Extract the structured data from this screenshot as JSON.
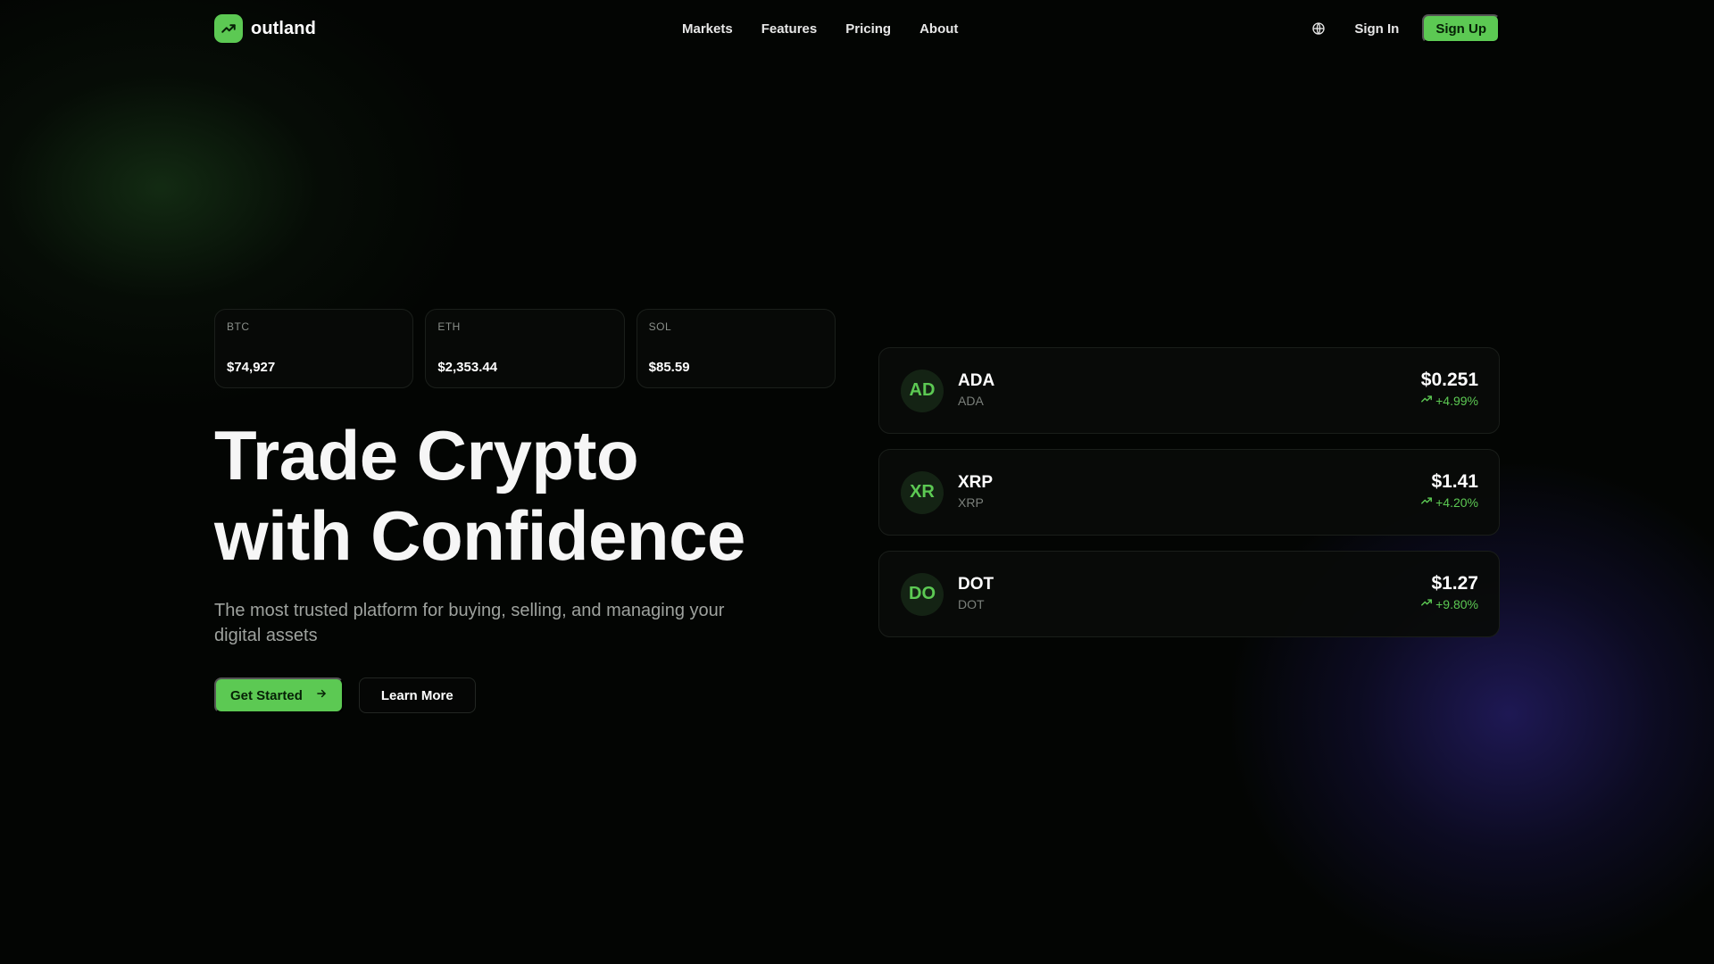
{
  "theme": {
    "accent": "#5cc953",
    "background": "#030503",
    "glow_green": "#1e4a1e",
    "glow_blue": "#3428a0"
  },
  "navbar": {
    "brand_name": "outland",
    "brand_icon": "trending-up-icon",
    "links": [
      "Markets",
      "Features",
      "Pricing",
      "About"
    ],
    "language_icon": "globe-icon",
    "sign_in": "Sign In",
    "sign_up": "Sign Up"
  },
  "tickers": [
    {
      "symbol": "BTC",
      "price": "$74,927"
    },
    {
      "symbol": "ETH",
      "price": "$2,353.44"
    },
    {
      "symbol": "SOL",
      "price": "$85.59"
    }
  ],
  "hero": {
    "title_line_1": "Trade Crypto",
    "title_line_2": "with Confidence",
    "subtitle": "The most trusted platform for buying, selling, and managing your digital assets",
    "primary_cta": "Get Started",
    "primary_cta_icon": "arrow-right-icon",
    "secondary_cta": "Learn More"
  },
  "markets": [
    {
      "avatar": "AD",
      "name": "ADA",
      "ticker": "ADA",
      "price": "$0.251",
      "change": "+4.99%"
    },
    {
      "avatar": "XR",
      "name": "XRP",
      "ticker": "XRP",
      "price": "$1.41",
      "change": "+4.20%"
    },
    {
      "avatar": "DO",
      "name": "DOT",
      "ticker": "DOT",
      "price": "$1.27",
      "change": "+9.80%"
    }
  ]
}
